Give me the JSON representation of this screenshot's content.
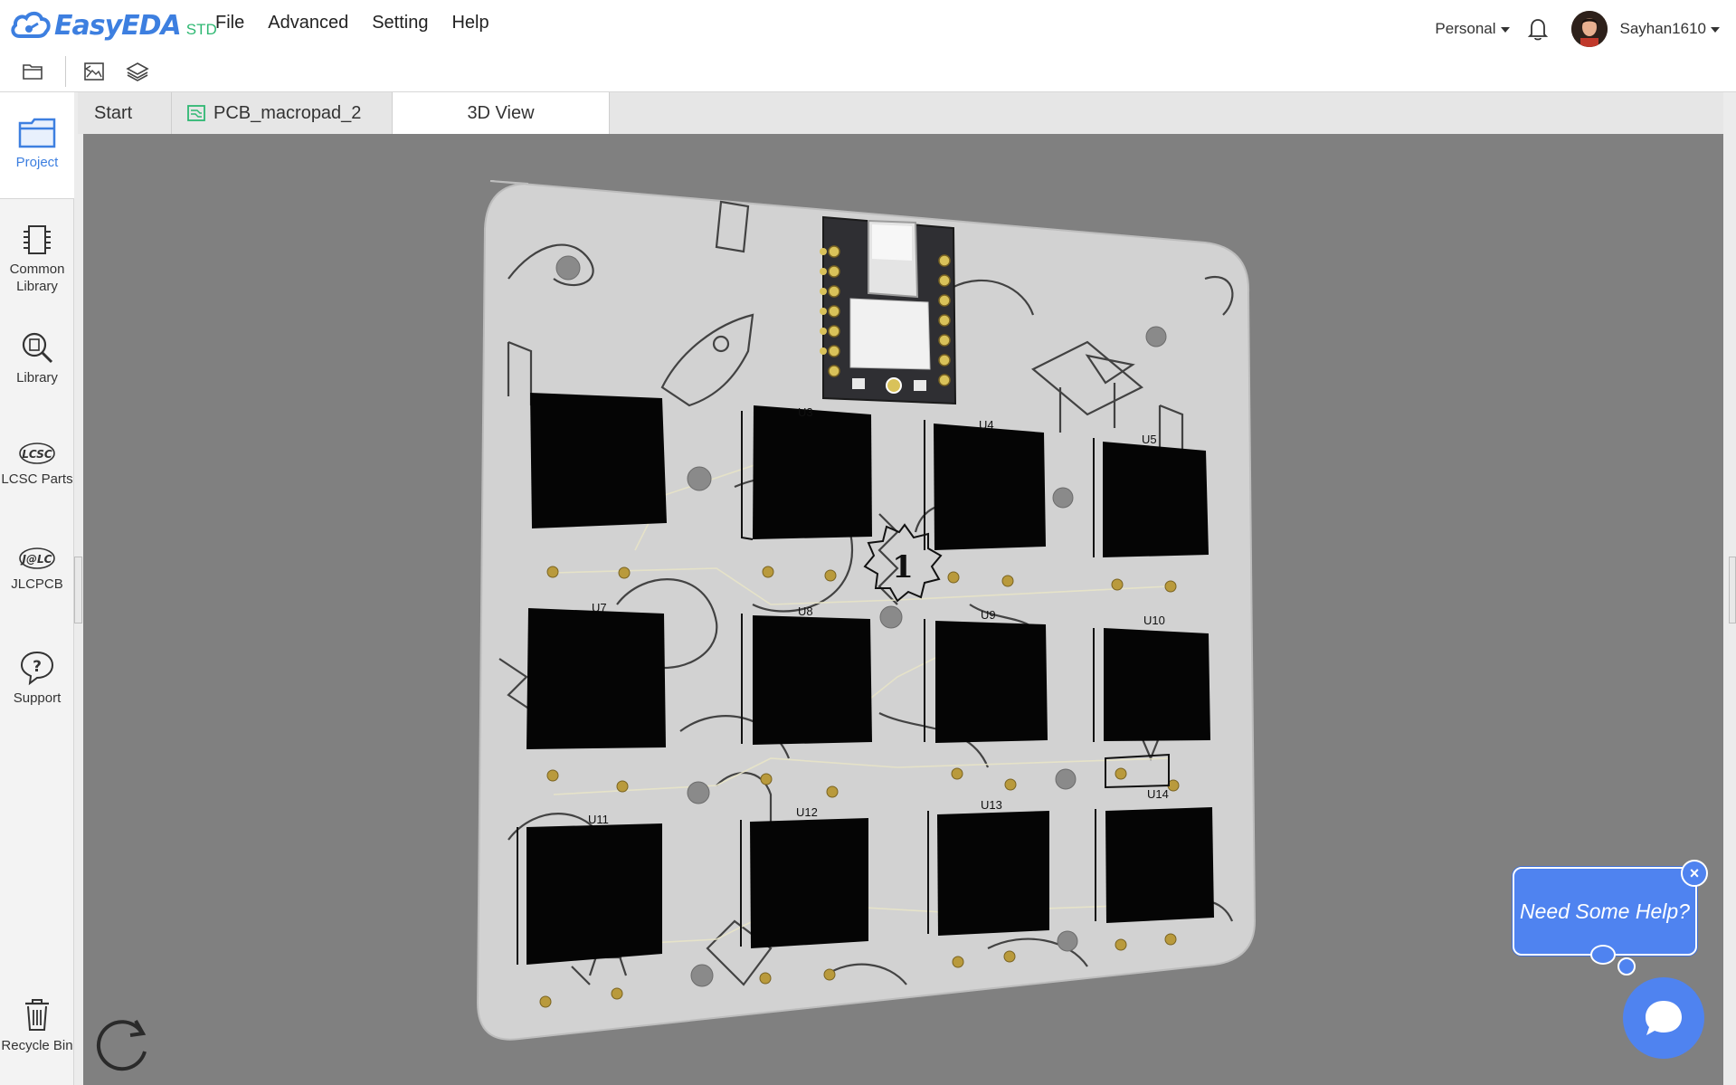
{
  "app": {
    "logo_text": "EasyEDA",
    "logo_edition": "STD",
    "brand_color": "#3d7fe0",
    "edition_color": "#2eb872"
  },
  "menu": {
    "file": "File",
    "advanced": "Advanced",
    "setting": "Setting",
    "help": "Help"
  },
  "account": {
    "workspace": "Personal",
    "username": "Sayhan1610"
  },
  "toolbar": {
    "icons": [
      "folder-icon",
      "image-export-icon",
      "layers-icon"
    ]
  },
  "sidebar": {
    "items": [
      {
        "label": "Project",
        "icon": "project-folder-icon",
        "active": true
      },
      {
        "label": "Common Library",
        "icon": "chip-icon"
      },
      {
        "label": "Library",
        "icon": "magnifier-chip-icon"
      },
      {
        "label": "LCSC Parts",
        "icon": "lcsc-logo-icon"
      },
      {
        "label": "JLCPCB",
        "icon": "jlc-logo-icon"
      },
      {
        "label": "Support",
        "icon": "question-bubble-icon"
      },
      {
        "label": "Recycle Bin",
        "icon": "trash-icon"
      }
    ]
  },
  "tabs": [
    {
      "label": "Start"
    },
    {
      "label": "PCB_macropad_2",
      "icon": "pcb-icon"
    },
    {
      "label": "3D View",
      "active": true
    }
  ],
  "viewer": {
    "background": "#808080",
    "board_color": "#d2d2d2",
    "component_labels": [
      "U3",
      "U4",
      "U5",
      "U7",
      "U8",
      "U9",
      "U10",
      "U11",
      "U12",
      "U13",
      "U14"
    ],
    "center_badge": "1"
  },
  "help": {
    "bubble_text": "Need Some Help?",
    "close": "×"
  }
}
